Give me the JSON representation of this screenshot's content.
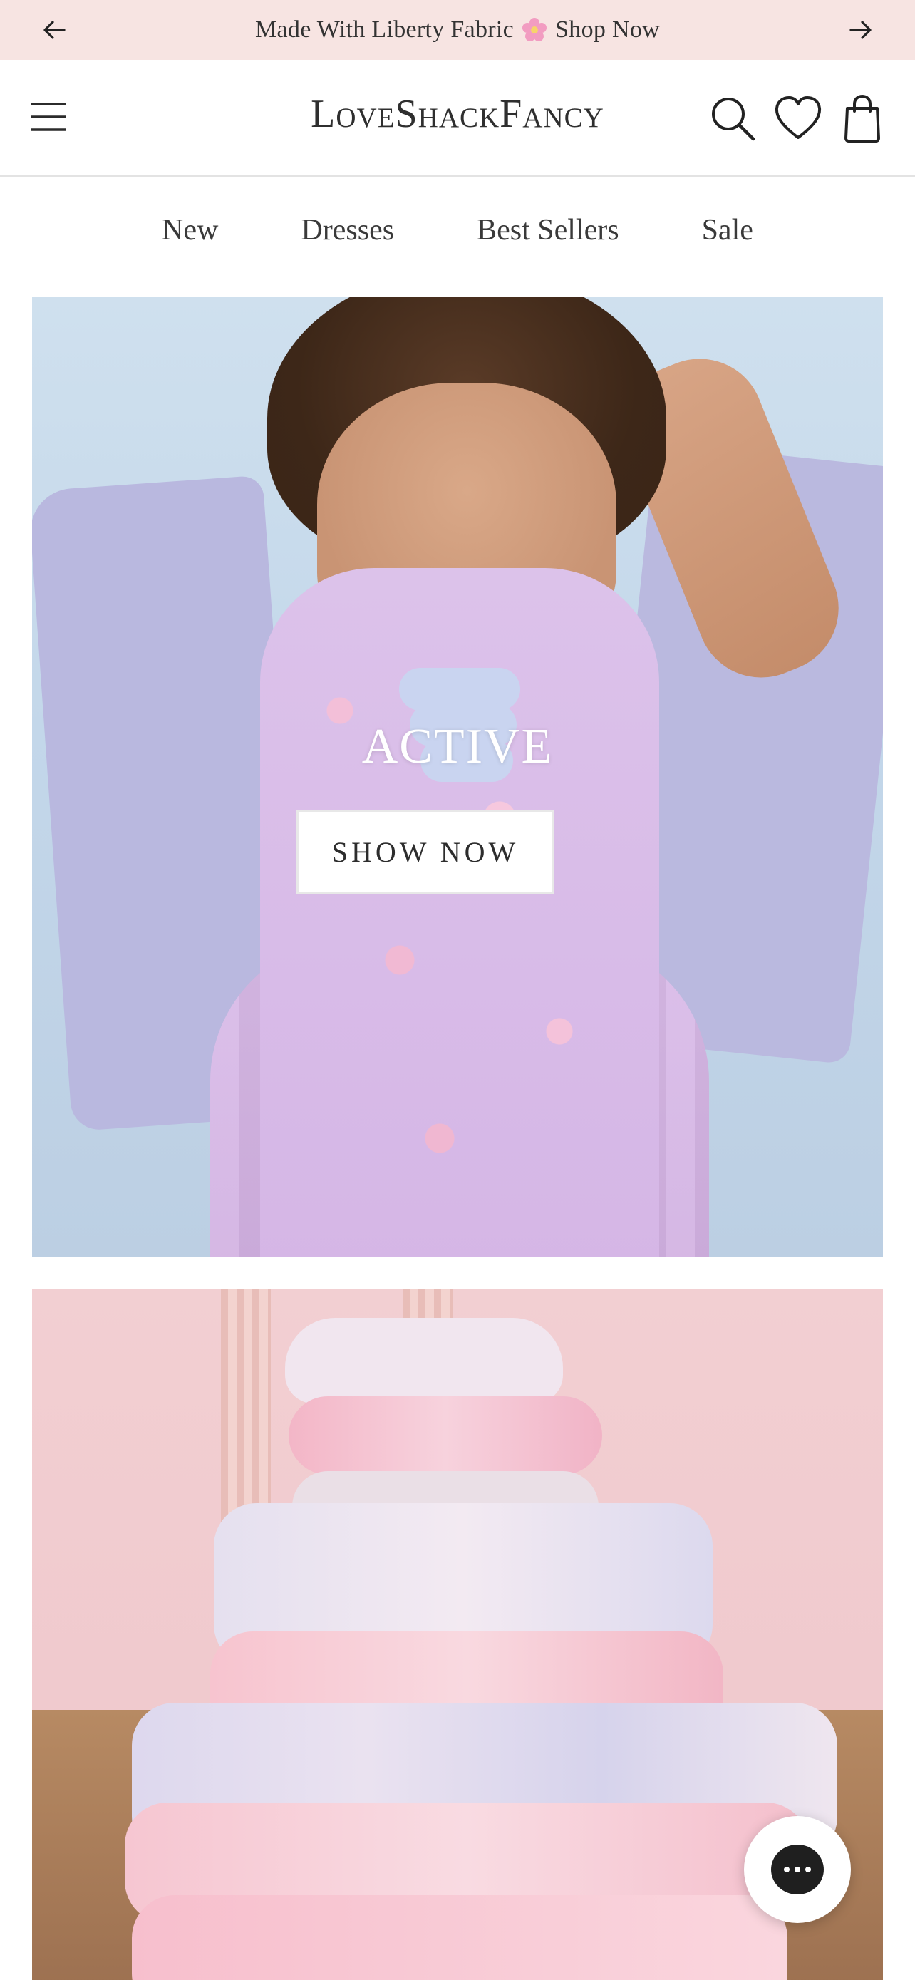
{
  "announcement": {
    "text_before": "Made With Liberty Fabric",
    "text_after": "Shop Now",
    "background": "#f7e4e2",
    "icons": {
      "prev": "arrow-left-icon",
      "next": "arrow-right-icon",
      "emoji": "pink-flower-icon"
    }
  },
  "header": {
    "logo": "LoveShackFancy",
    "icons": [
      "menu-icon",
      "search-icon",
      "heart-icon",
      "shopping-bag-icon"
    ]
  },
  "nav": {
    "items": [
      "New",
      "Dresses",
      "Best Sellers",
      "Sale"
    ]
  },
  "hero": {
    "title": "ACTIVE",
    "button_label": "SHOW NOW"
  },
  "chat": {
    "icon": "chat-bubble-icon"
  },
  "colors": {
    "accent_pink": "#f7e4e2",
    "text": "#2b2b2b"
  }
}
